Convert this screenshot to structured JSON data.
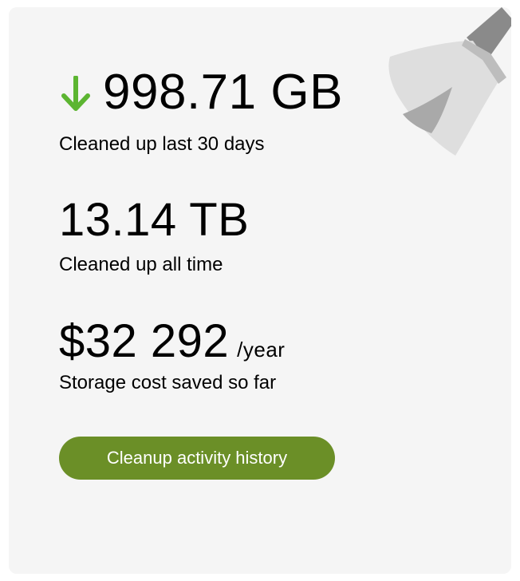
{
  "stats": {
    "last30": {
      "value": "998.71 GB",
      "label": "Cleaned up last 30 days",
      "trend_icon": "arrow-down-icon",
      "trend_color": "#5cb531"
    },
    "alltime": {
      "value": "13.14 TB",
      "label": "Cleaned up all time"
    },
    "cost": {
      "value": "$32 292",
      "unit": "/year",
      "label": "Storage cost saved so far"
    }
  },
  "button": {
    "label": "Cleanup activity history",
    "color": "#6b8f27"
  },
  "decoration": {
    "icon": "broom-icon"
  },
  "colors": {
    "card_background": "#f5f5f5",
    "text": "#000000"
  }
}
